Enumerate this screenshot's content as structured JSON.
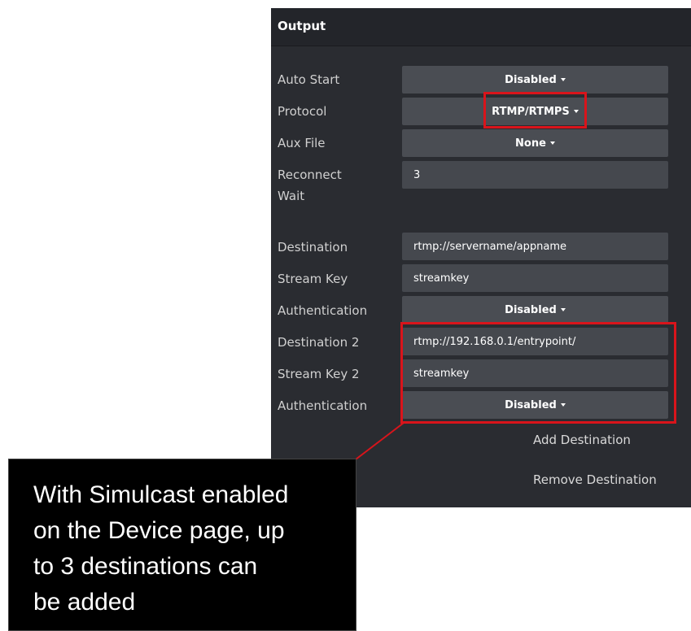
{
  "panel": {
    "title": "Output"
  },
  "rows": {
    "auto_start": {
      "label": "Auto Start",
      "value": "Disabled"
    },
    "protocol": {
      "label": "Protocol",
      "value": "RTMP/RTMPS"
    },
    "aux_file": {
      "label": "Aux File",
      "value": "None"
    },
    "reconnect_wait": {
      "label_line1": "Reconnect",
      "label_line2": "Wait",
      "value": "3"
    },
    "destination": {
      "label": "Destination",
      "value": "rtmp://servername/appname"
    },
    "stream_key": {
      "label": "Stream Key",
      "value": "streamkey"
    },
    "authentication": {
      "label": "Authentication",
      "value": "Disabled"
    },
    "destination_2": {
      "label": "Destination 2",
      "value": "rtmp://192.168.0.1/entrypoint/"
    },
    "stream_key_2": {
      "label": "Stream Key 2",
      "value": "streamkey"
    },
    "authentication_2": {
      "label": "Authentication",
      "value": "Disabled"
    }
  },
  "actions": {
    "add_destination": "Add Destination",
    "remove_destination": "Remove Destination"
  },
  "callout": {
    "lines": [
      "With Simulcast enabled",
      "on the Device page, up",
      "to 3 destinations can",
      "be added"
    ]
  },
  "colors": {
    "highlight": "#d9141b",
    "panel_background": "#2a2c31",
    "field_background": "#45484e"
  }
}
